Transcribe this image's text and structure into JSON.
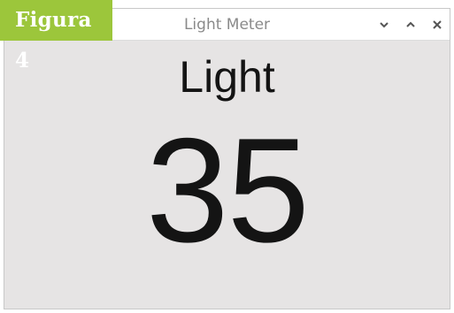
{
  "badge": {
    "label": "Figura 4",
    "color": "#9cc63b"
  },
  "window": {
    "title": "Light Meter",
    "controls": {
      "minimize_icon": "chevron-down-icon",
      "maximize_icon": "chevron-up-icon",
      "close_icon": "close-icon"
    }
  },
  "sensor": {
    "label": "Light",
    "value": "35"
  }
}
